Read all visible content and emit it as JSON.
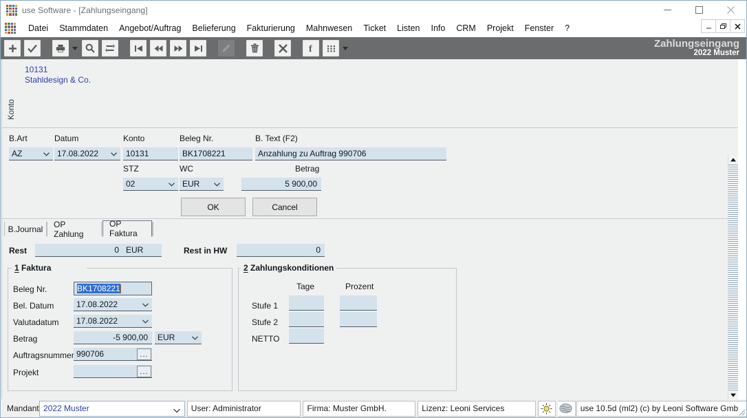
{
  "window": {
    "title": "use Software - [Zahlungseingang]",
    "app_icon": "app-grid-icon",
    "controls": {
      "minimize": "minimize-icon",
      "maximize": "maximize-icon",
      "close": "close-icon"
    },
    "mdi_controls": {
      "minimize": "_",
      "restore": "restore-icon",
      "close": "x"
    }
  },
  "menu": {
    "items": [
      {
        "label": "Datei"
      },
      {
        "label": "Stammdaten"
      },
      {
        "label": "Angebot/Auftrag"
      },
      {
        "label": "Belieferung"
      },
      {
        "label": "Fakturierung"
      },
      {
        "label": "Mahnwesen"
      },
      {
        "label": "Ticket"
      },
      {
        "label": "Listen"
      },
      {
        "label": "Info"
      },
      {
        "label": "CRM"
      },
      {
        "label": "Projekt"
      },
      {
        "label": "Fenster"
      },
      {
        "label": "?"
      }
    ]
  },
  "toolbar": {
    "buttons": [
      {
        "name": "new-icon",
        "glyph": "+"
      },
      {
        "name": "confirm-check-icon",
        "glyph": "check"
      },
      {
        "name": "print-icon",
        "glyph": "printer"
      },
      {
        "name": "print-dropdown-caret-icon",
        "glyph": "caret-down"
      },
      {
        "name": "search-icon",
        "glyph": "magnifier"
      },
      {
        "name": "refresh-icon",
        "glyph": "refresh"
      },
      {
        "name": "first-record-icon",
        "glyph": "first"
      },
      {
        "name": "previous-record-icon",
        "glyph": "prev"
      },
      {
        "name": "next-record-icon",
        "glyph": "next"
      },
      {
        "name": "last-record-icon",
        "glyph": "last"
      },
      {
        "name": "edit-pencil-icon",
        "glyph": "pencil"
      },
      {
        "name": "delete-trash-icon",
        "glyph": "trash"
      },
      {
        "name": "cancel-x-icon",
        "glyph": "x"
      },
      {
        "name": "facebook-f-icon",
        "glyph": "f"
      },
      {
        "name": "grid-apps-icon",
        "glyph": "grid"
      },
      {
        "name": "grid-dropdown-caret-icon",
        "glyph": "caret-down"
      }
    ],
    "title_main": "Zahlungseingang",
    "title_sub": "2022 Muster"
  },
  "konto": {
    "label": "Konto",
    "number": "10131",
    "name": "Stahldesign & Co."
  },
  "booking": {
    "labels": {
      "bart": "B.Art",
      "datum": "Datum",
      "konto": "Konto",
      "beleg_nr": "Beleg Nr.",
      "btext": "B. Text (F2)",
      "stz": "STZ",
      "wc": "WC",
      "betrag": "Betrag"
    },
    "values": {
      "bart": "AZ",
      "datum": "17.08.2022",
      "konto": "10131",
      "beleg_nr": "BK1708221",
      "btext": "Anzahlung zu Auftrag 990706",
      "stz": "02",
      "wc": "EUR",
      "betrag": "5 900,00"
    }
  },
  "dialog_buttons": {
    "ok": "OK",
    "cancel": "Cancel"
  },
  "tabs": [
    {
      "label": "B.Journal",
      "active": false
    },
    {
      "label": "OP Zahlung",
      "active": false
    },
    {
      "label": "OP Faktura",
      "active": true
    }
  ],
  "rest_row": {
    "rest_label": "Rest",
    "rest_value": "0",
    "rest_currency": "EUR",
    "rest_hw_label": "Rest in HW",
    "rest_hw_value": "0"
  },
  "faktura": {
    "group_number": "1",
    "group_title": "Faktura",
    "fields": {
      "beleg_nr_label": "Beleg Nr.",
      "beleg_nr_value": "BK1708221",
      "bel_datum_label": "Bel. Datum",
      "bel_datum_value": "17.08.2022",
      "valutadatum_label": "Valutadatum",
      "valutadatum_value": "17.08.2022",
      "betrag_label": "Betrag",
      "betrag_value": "-5 900,00",
      "betrag_currency": "EUR",
      "auftragsnummer_label": "Auftragsnummer",
      "auftragsnummer_value": "990706",
      "projekt_label": "Projekt",
      "projekt_value": ""
    },
    "ellipsis_glyph": "..."
  },
  "zahlungskonditionen": {
    "group_number": "2",
    "group_title": "Zahlungskonditionen",
    "col_tage": "Tage",
    "col_prozent": "Prozent",
    "rows": [
      {
        "label": "Stufe 1",
        "tage": "",
        "prozent": ""
      },
      {
        "label": "Stufe 2",
        "tage": "",
        "prozent": ""
      },
      {
        "label": "NETTO",
        "tage": "",
        "prozent": null
      }
    ]
  },
  "statusbar": {
    "mandant_label": "Mandant",
    "mandant_value": "2022 Muster",
    "user": "User: Administrator",
    "firma": "Firma: Muster GmbH.",
    "lizenz": "Lizenz: Leoni Services",
    "icon_sun": "sun-icon",
    "icon_brain": "brain-icon",
    "version": "use 10.5d (ml2) (c) by Leoni Software Gmb"
  },
  "colors": {
    "toolbar_bg": "#6a6c6e",
    "field_bg": "#d4e2ec",
    "client_bg": "#eff0f0",
    "link_text": "#2b3fa8",
    "selection": "#2f6fd0"
  }
}
